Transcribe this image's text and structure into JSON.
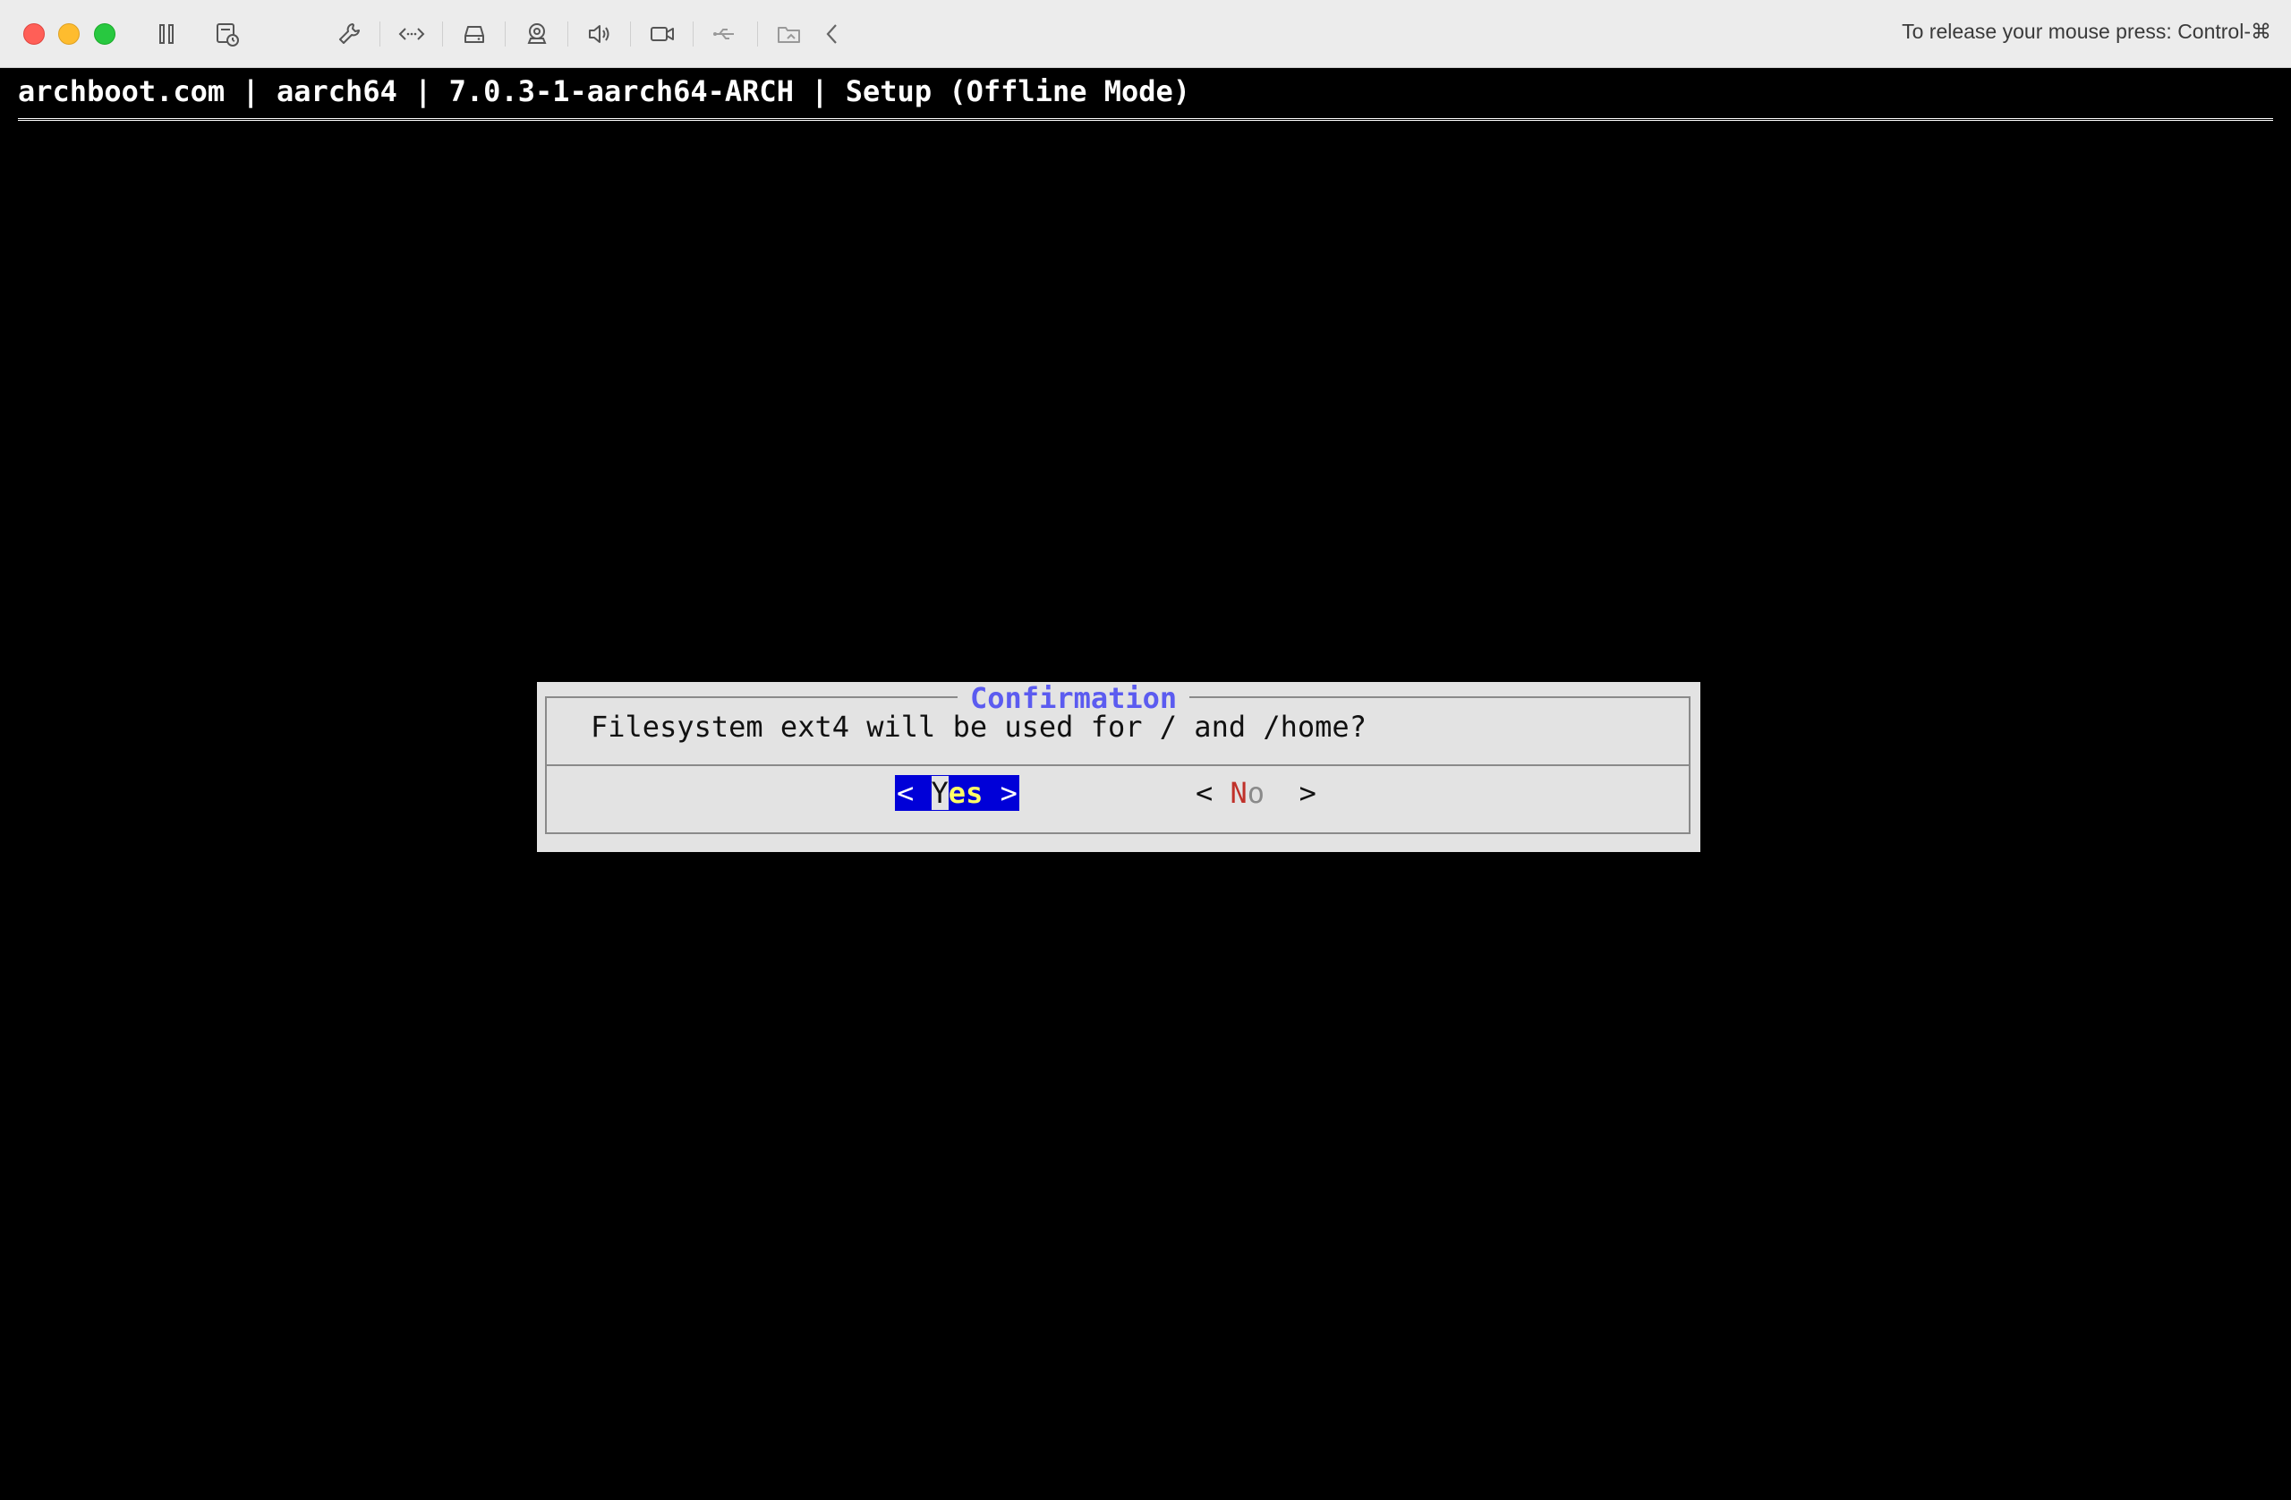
{
  "toolbar": {
    "icons": [
      "pause-icon",
      "snapshot-icon",
      "settings-wrench-icon",
      "code-icon",
      "disk-icon",
      "camera-icon",
      "audio-icon",
      "video-icon",
      "usb-icon",
      "shared-folder-icon",
      "chevron-left-icon"
    ],
    "release_message": "To release your mouse press: Control-⌘"
  },
  "terminal": {
    "title": "archboot.com | aarch64 | 7.0.3-1-aarch64-ARCH | Setup (Offline Mode)"
  },
  "dialog": {
    "title": "Confirmation",
    "message": "Filesystem ext4 will be used for / and /home?",
    "yes": {
      "open": "< ",
      "hotkey": "Y",
      "rest": "es",
      "close": " >"
    },
    "no": {
      "open": "< ",
      "hotkey": "N",
      "rest": "o",
      "close": "  >"
    }
  },
  "colors": {
    "terminal_bg": "#000000",
    "dialog_bg": "#e3e3e3",
    "dialog_title": "#5b5bf0",
    "selected_button_bg": "#0000d8",
    "hotkey_selected": "#ffff66",
    "hotkey_unselected": "#c0312a"
  }
}
